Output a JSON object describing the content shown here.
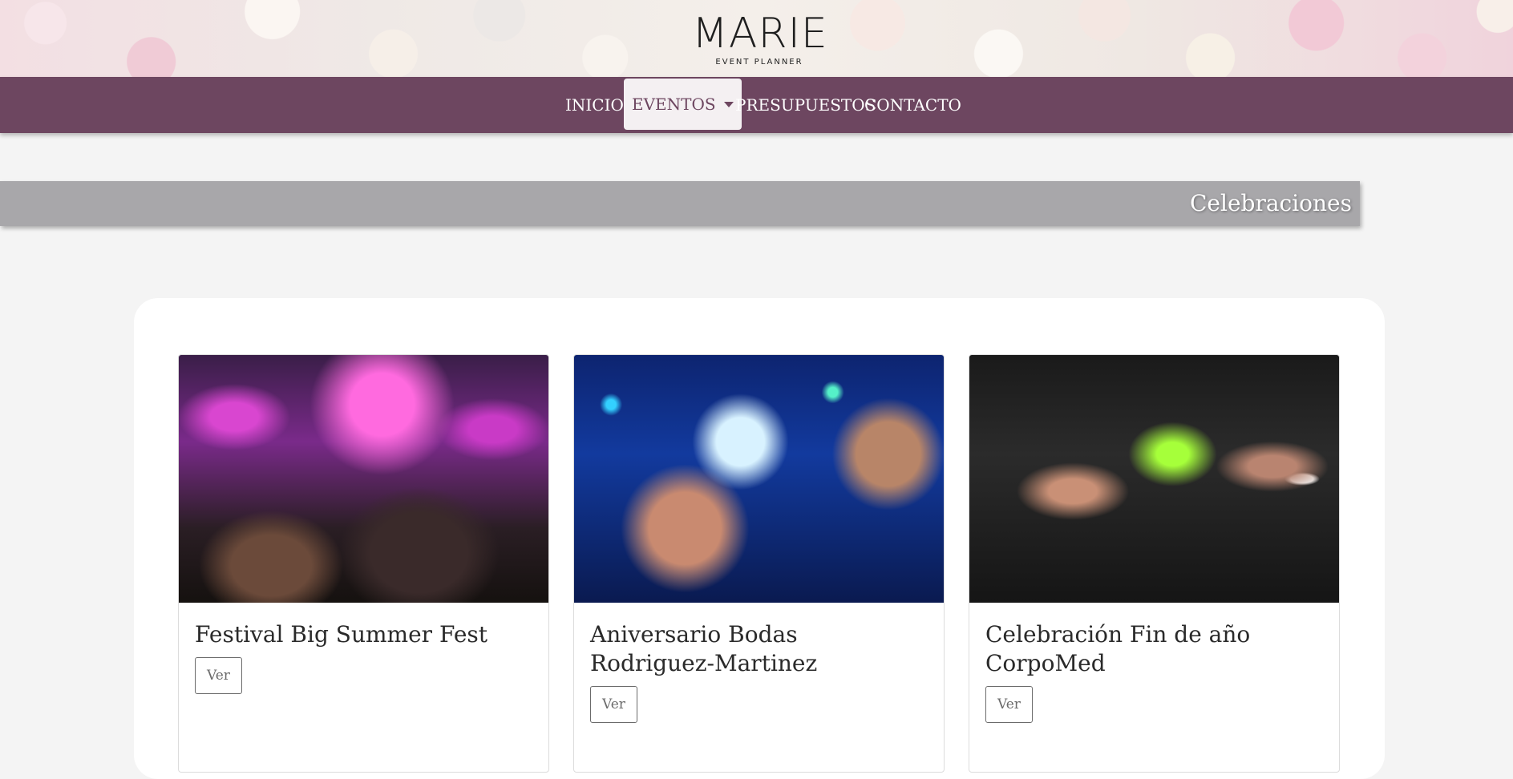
{
  "brand": {
    "name": "MARIE",
    "tagline": "EVENT PLANNER"
  },
  "nav": {
    "items": [
      {
        "label": "INICIO"
      },
      {
        "label": "EVENTOS"
      },
      {
        "label": "PRESUPUESTOS"
      },
      {
        "label": "CONTACTO"
      }
    ],
    "active": "EVENTOS"
  },
  "section": {
    "title": "Celebraciones"
  },
  "cards": [
    {
      "title": "Festival Big Summer Fest",
      "button": "Ver"
    },
    {
      "title": "Aniversario Bodas Rodriguez-Martinez",
      "button": "Ver"
    },
    {
      "title": "Celebración Fin de año CorpoMed",
      "button": "Ver"
    }
  ],
  "colors": {
    "nav_bg": "#6d4660",
    "banner_bg": "#a8a7aa",
    "page_bg": "#f4f4f4"
  }
}
